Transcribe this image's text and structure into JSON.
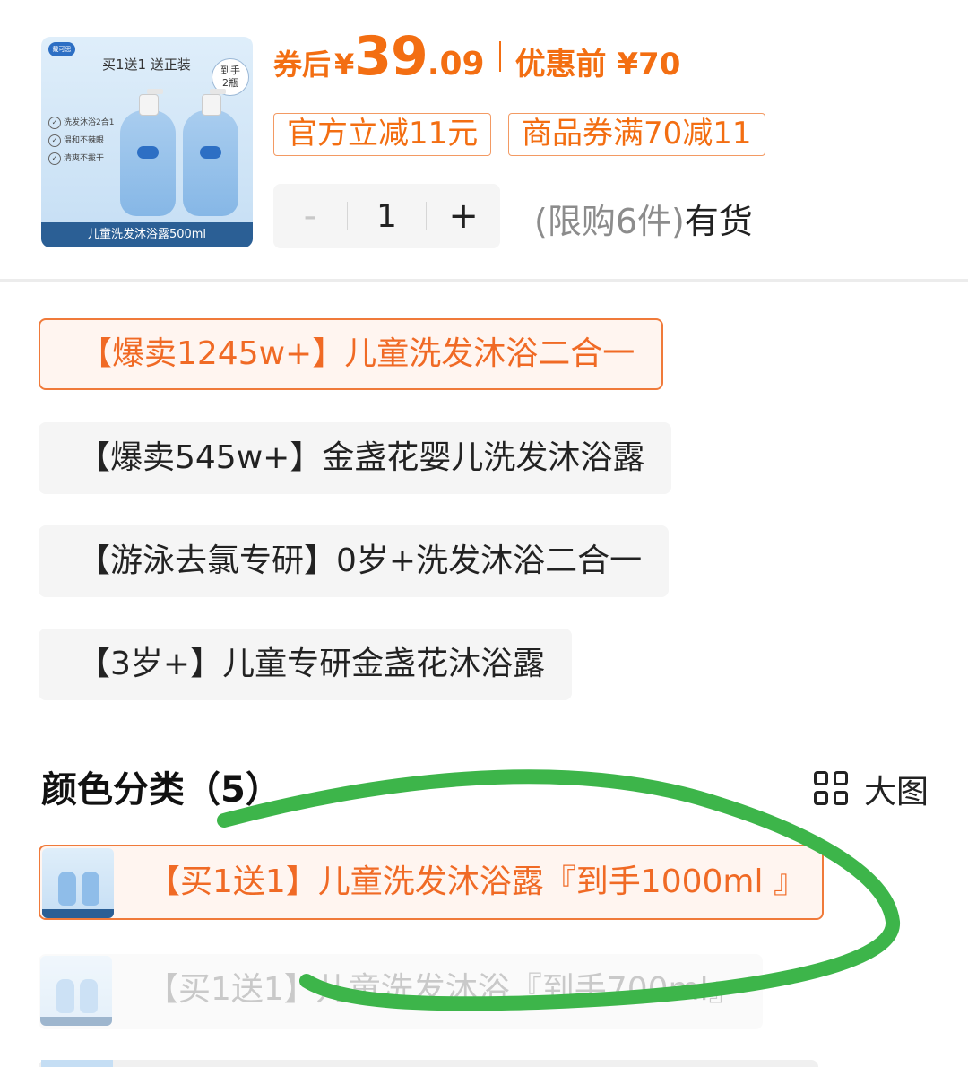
{
  "product": {
    "thumbnail": {
      "brand": "戴可思",
      "promo": "买1送1 送正装",
      "badge_line1": "到手",
      "badge_line2": "2瓶",
      "features": [
        "洗发沐浴2合1",
        "温和不辣眼",
        "清爽不拔干"
      ],
      "caption": "儿童洗发沐浴露500ml"
    },
    "price": {
      "label": "券后",
      "currency": "¥",
      "integer": "39",
      "decimal": ".09",
      "before_text": "优惠前 ¥70"
    },
    "tags": [
      "官方立减11元",
      "商品券满70减11"
    ],
    "quantity": {
      "minus": "-",
      "value": "1",
      "plus": "+"
    },
    "stock": {
      "limit": "(限购6件)",
      "status": "有货"
    }
  },
  "variants": [
    {
      "label": "【爆卖1245w+】儿童洗发沐浴二合一",
      "selected": true
    },
    {
      "label": "【爆卖545w+】金盏花婴儿洗发沐浴露",
      "selected": false
    },
    {
      "label": "【游泳去氯专研】0岁+洗发沐浴二合一",
      "selected": false
    },
    {
      "label": "【3岁+】儿童专研金盏花沐浴露",
      "selected": false
    }
  ],
  "color_section": {
    "title": "颜色分类（5）",
    "view_toggle_icon": "grid-icon",
    "view_toggle_label": "大图",
    "options": [
      {
        "label": "【买1送1】儿童洗发沐浴露『到手1000ml 』",
        "selected": true
      },
      {
        "label": "【买1送1】儿童洗发沐浴『到手700ml』",
        "selected": false
      }
    ]
  },
  "colors": {
    "accent": "#f36e12",
    "selected_border": "#f07a3a",
    "chip_bg": "#f5f5f5",
    "annotation_stroke": "#3db54a"
  }
}
